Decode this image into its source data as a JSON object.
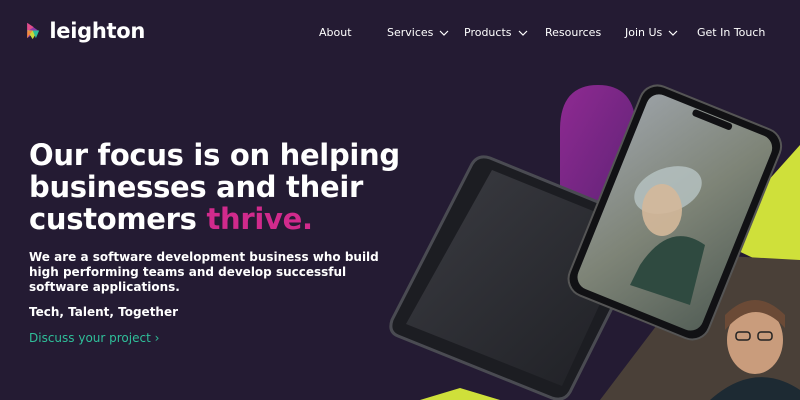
{
  "brand": {
    "name": "leighton"
  },
  "nav": {
    "items": [
      {
        "label": "About",
        "has_dropdown": false
      },
      {
        "label": "Services",
        "has_dropdown": true
      },
      {
        "label": "Products",
        "has_dropdown": true
      },
      {
        "label": "Resources",
        "has_dropdown": false
      },
      {
        "label": "Join Us",
        "has_dropdown": true
      },
      {
        "label": "Get In Touch",
        "has_dropdown": false
      }
    ]
  },
  "hero": {
    "title_line1": "Our focus is on helping",
    "title_line2": "businesses and their",
    "title_line3_start": "customers ",
    "title_accent": "thrive.",
    "description": "We are a software development business who build high performing teams and develop successful software applications.",
    "tagline": "Tech, Talent, Together",
    "cta_label": "Discuss your project ›"
  },
  "colors": {
    "background": "#241b33",
    "accent_pink": "#d12a8c",
    "link_green": "#2fbf9a",
    "shape_purple": "#8b2a8f",
    "shape_lime": "#cfe03a"
  },
  "icons": [
    "logo-mark-icon",
    "chevron-down-icon"
  ]
}
